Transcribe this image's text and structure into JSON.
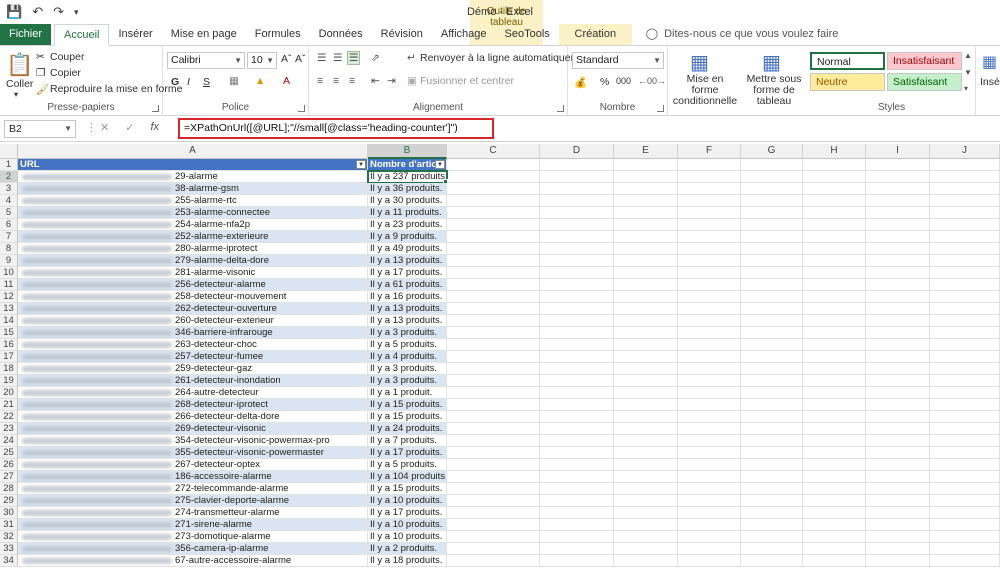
{
  "title_bar": {
    "doc_title": "Démo  -  Excel",
    "context_label": "Outils de tableau"
  },
  "qat": {
    "save_icon": "save-icon",
    "undo_icon": "undo-icon",
    "redo_icon": "redo-icon"
  },
  "tabs": {
    "file": "Fichier",
    "items": [
      "Accueil",
      "Insérer",
      "Mise en page",
      "Formules",
      "Données",
      "Révision",
      "Affichage",
      "SeoTools"
    ],
    "context_tab": "Création",
    "tell_me": "Dites-nous ce que vous voulez faire"
  },
  "ribbon": {
    "clipboard": {
      "paste": "Coller",
      "cut": "Couper",
      "copy": "Copier",
      "format_painter": "Reproduire la mise en forme",
      "label": "Presse-papiers"
    },
    "font": {
      "name": "Calibri",
      "size": "10",
      "bold": "G",
      "italic": "I",
      "underline": "S",
      "label": "Police"
    },
    "alignment": {
      "wrap": "Renvoyer à la ligne automatiquement",
      "merge": "Fusionner et centrer",
      "label": "Alignement"
    },
    "number": {
      "format": "Standard",
      "percent": "%",
      "thousands": "000",
      "label": "Nombre"
    },
    "cond_format": "Mise en forme conditionnelle",
    "table_format": "Mettre sous forme de tableau",
    "styles": {
      "normal": "Normal",
      "bad": "Insatisfaisant",
      "neutral": "Neutre",
      "good": "Satisfaisant",
      "label": "Styles"
    },
    "insert_cut": "Insé"
  },
  "formula_bar": {
    "name_box": "B2",
    "fx": "fx",
    "formula": "=XPathOnUrl([@URL];\"//small[@class='heading-counter']\")"
  },
  "colors": {
    "excel_green": "#217346",
    "header_blue": "#4472c4",
    "band": "#dbe4f1",
    "formula_border": "#d9262c"
  },
  "columns": [
    "A",
    "B",
    "C",
    "D",
    "E",
    "F",
    "G",
    "H",
    "I",
    "J"
  ],
  "table": {
    "headers": [
      "URL",
      "Nombre d'article"
    ],
    "rows": [
      [
        "29-alarme",
        "Il y a 237 produits."
      ],
      [
        "38-alarme-gsm",
        "Il y a 36 produits."
      ],
      [
        "255-alarme-rtc",
        "Il y a 30 produits."
      ],
      [
        "253-alarme-connectee",
        "Il y a 11 produits."
      ],
      [
        "254-alarme-nfa2p",
        "Il y a 23 produits."
      ],
      [
        "252-alarme-exterieure",
        "Il y a 9 produits."
      ],
      [
        "280-alarme-iprotect",
        "Il y a 49 produits."
      ],
      [
        "279-alarme-delta-dore",
        "Il y a 13 produits."
      ],
      [
        "281-alarme-visonic",
        "Il y a 17 produits."
      ],
      [
        "256-detecteur-alarme",
        "Il y a 61 produits."
      ],
      [
        "258-detecteur-mouvement",
        "Il y a 16 produits."
      ],
      [
        "262-detecteur-ouverture",
        "Il y a 13 produits."
      ],
      [
        "260-detecteur-exterieur",
        "Il y a 13 produits."
      ],
      [
        "346-barriere-infrarouge",
        "Il y a 3 produits."
      ],
      [
        "263-detecteur-choc",
        "Il y a 5 produits."
      ],
      [
        "257-detecteur-fumee",
        "Il y a 4 produits."
      ],
      [
        "259-detecteur-gaz",
        "Il y a 3 produits."
      ],
      [
        "261-detecteur-inondation",
        "Il y a 3 produits."
      ],
      [
        "264-autre-detecteur",
        "Il y a 1 produit."
      ],
      [
        "268-detecteur-iprotect",
        "Il y a 15 produits."
      ],
      [
        "266-detecteur-delta-dore",
        "Il y a 15 produits."
      ],
      [
        "269-detecteur-visonic",
        "Il y a 24 produits."
      ],
      [
        "354-detecteur-visonic-powermax-pro",
        "Il y a 7 produits."
      ],
      [
        "355-detecteur-visonic-powermaster",
        "Il y a 17 produits."
      ],
      [
        "267-detecteur-optex",
        "Il y a 5 produits."
      ],
      [
        "186-accessoire-alarme",
        "Il y a 104 produits."
      ],
      [
        "272-telecommande-alarme",
        "Il y a 15 produits."
      ],
      [
        "275-clavier-deporte-alarme",
        "Il y a 10 produits."
      ],
      [
        "274-transmetteur-alarme",
        "Il y a 17 produits."
      ],
      [
        "271-sirene-alarme",
        "Il y a 10 produits."
      ],
      [
        "273-domotique-alarme",
        "Il y a 10 produits."
      ],
      [
        "356-camera-ip-alarme",
        "Il y a 2 produits."
      ],
      [
        "67-autre-accessoire-alarme",
        "Il y a 18 produits."
      ]
    ]
  }
}
